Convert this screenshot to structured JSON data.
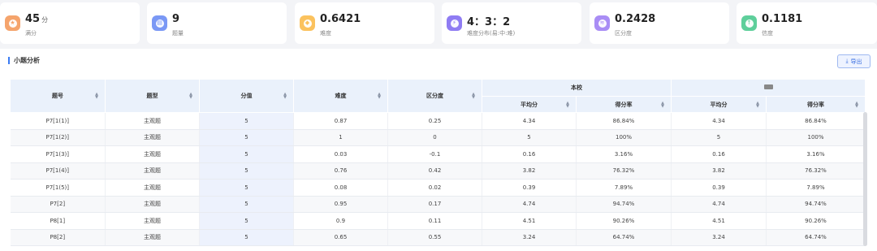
{
  "stats": [
    {
      "value": "45",
      "unit": "分",
      "label": "满分",
      "icon": "star-icon",
      "color": "#f5a46c"
    },
    {
      "value": "9",
      "unit": "",
      "label": "题量",
      "icon": "document-icon",
      "color": "#7a98f5"
    },
    {
      "value": "0.6421",
      "unit": "",
      "label": "难度",
      "icon": "diamond-icon",
      "color": "#fbc25e"
    },
    {
      "value": "4：3：2",
      "unit": "",
      "label": "难度分布(易:中:难)",
      "icon": "lightning-icon",
      "color": "#8f7cf3"
    },
    {
      "value": "0.2428",
      "unit": "",
      "label": "区分度",
      "icon": "layers-icon",
      "color": "#a98df5"
    },
    {
      "value": "0.1181",
      "unit": "",
      "label": "信度",
      "icon": "arrow-up-circle-icon",
      "color": "#5ecf9b"
    }
  ],
  "panel": {
    "title": "小题分析",
    "export_label": "导出",
    "export_icon": "download-icon"
  },
  "table": {
    "headers": {
      "num": "题号",
      "type": "题型",
      "score": "分值",
      "difficulty": "难度",
      "discrimination": "区分度",
      "school_group": "本校",
      "avg": "平均分",
      "rate": "得分率"
    },
    "rows": [
      [
        "P7[1(1)]",
        "主观题",
        "5",
        "0.87",
        "0.25",
        "4.34",
        "86.84%",
        "4.34",
        "86.84%"
      ],
      [
        "P7[1(2)]",
        "主观题",
        "5",
        "1",
        "0",
        "5",
        "100%",
        "5",
        "100%"
      ],
      [
        "P7[1(3)]",
        "主观题",
        "5",
        "0.03",
        "-0.1",
        "0.16",
        "3.16%",
        "0.16",
        "3.16%"
      ],
      [
        "P7[1(4)]",
        "主观题",
        "5",
        "0.76",
        "0.42",
        "3.82",
        "76.32%",
        "3.82",
        "76.32%"
      ],
      [
        "P7[1(5)]",
        "主观题",
        "5",
        "0.08",
        "0.02",
        "0.39",
        "7.89%",
        "0.39",
        "7.89%"
      ],
      [
        "P7[2]",
        "主观题",
        "5",
        "0.95",
        "0.17",
        "4.74",
        "94.74%",
        "4.74",
        "94.74%"
      ],
      [
        "P8[1]",
        "主观题",
        "5",
        "0.9",
        "0.11",
        "4.51",
        "90.26%",
        "4.51",
        "90.26%"
      ],
      [
        "P8[2]",
        "主观题",
        "5",
        "0.65",
        "0.55",
        "3.24",
        "64.74%",
        "3.24",
        "64.74%"
      ]
    ]
  }
}
